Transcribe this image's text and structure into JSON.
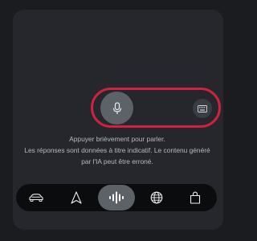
{
  "voice_panel": {
    "mic_icon": "microphone-icon",
    "keyboard_icon": "keyboard-icon",
    "highlight_color": "#d0223f"
  },
  "hint": {
    "line1": "Appuyer brièvement pour parler.",
    "line2": "Les réponses sont données à titre indicatif. Le contenu généré",
    "line3": "par l'IA peut être erroné."
  },
  "navbar": {
    "items": [
      {
        "icon": "car-icon",
        "active": false
      },
      {
        "icon": "navigation-arrow-icon",
        "active": false
      },
      {
        "icon": "voice-waveform-icon",
        "active": true
      },
      {
        "icon": "globe-icon",
        "active": false
      },
      {
        "icon": "shopping-bag-icon",
        "active": false
      }
    ]
  }
}
